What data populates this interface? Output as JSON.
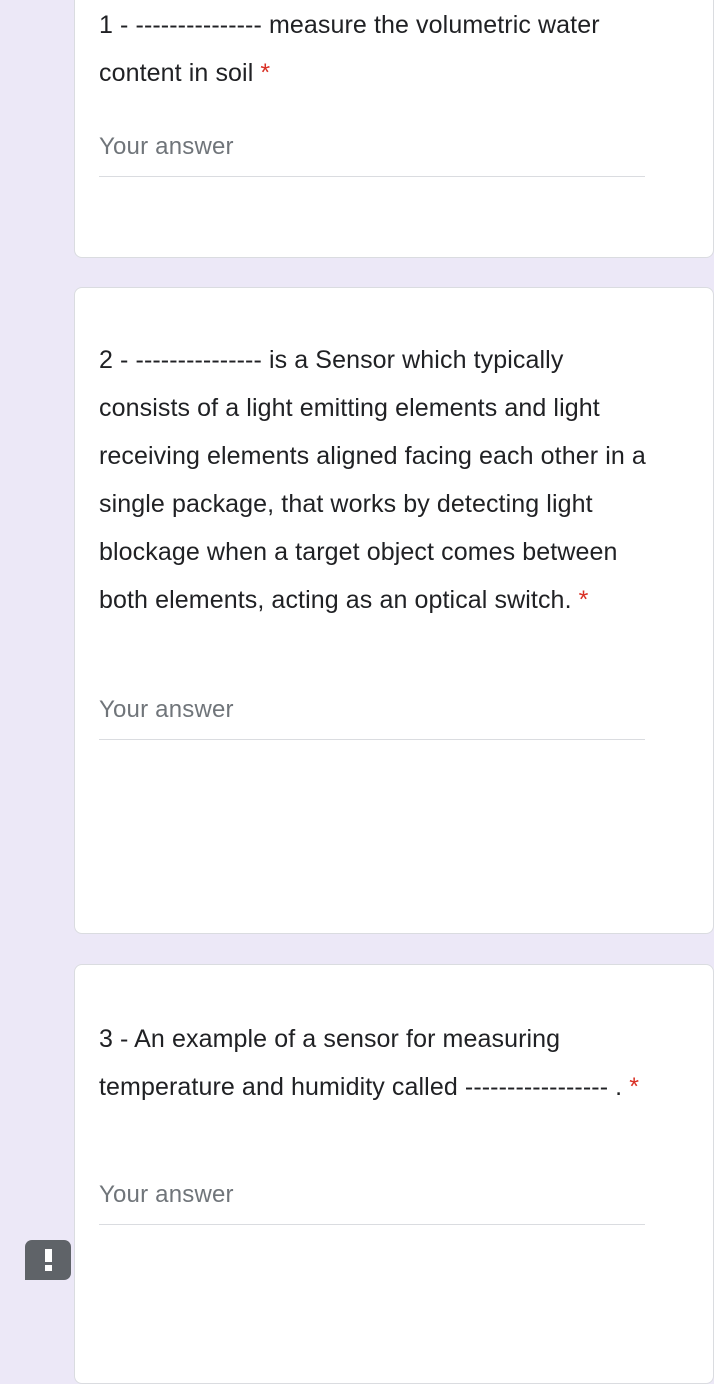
{
  "page": {
    "background_color": "#ece8f7",
    "card_background_color": "#ffffff",
    "required_marker_color": "#d93025",
    "answer_placeholder_color": "#70757a"
  },
  "questions": [
    {
      "id": "q1",
      "title": "1 - --------------- measure the volumetric water content in soil",
      "required_marker": "*",
      "answer": {
        "value": "",
        "placeholder": "Your answer"
      }
    },
    {
      "id": "q2",
      "title": "2 - --------------- is a Sensor which typically consists of a light emitting elements and light receiving elements aligned facing each other in a single package, that works by detecting light blockage when a target object comes between both elements, acting as an optical switch.",
      "required_marker": "*",
      "answer": {
        "value": "",
        "placeholder": "Your answer"
      }
    },
    {
      "id": "q3",
      "title": "3 - An example of a sensor for measuring temperature and humidity called ----------------- .",
      "required_marker": "*",
      "answer": {
        "value": "",
        "placeholder": "Your answer"
      }
    }
  ],
  "alert_badge": {
    "icon": "exclamation-icon",
    "label": "!"
  }
}
